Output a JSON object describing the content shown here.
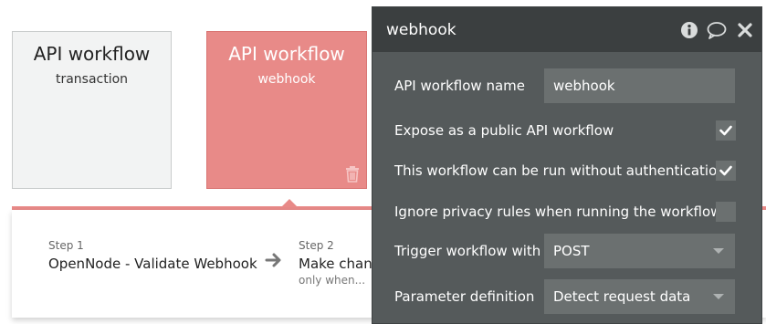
{
  "cards": [
    {
      "title": "API workflow",
      "subtitle": "transaction"
    },
    {
      "title": "API workflow",
      "subtitle": "webhook"
    }
  ],
  "steps": [
    {
      "number": "Step 1",
      "title": "OpenNode - Validate Webhook",
      "condition": ""
    },
    {
      "number": "Step 2",
      "title": "Make chang",
      "condition": "only when..."
    }
  ],
  "panel": {
    "title": "webhook",
    "fields": {
      "name_label": "API workflow name",
      "name_value": "webhook",
      "expose_label": "Expose as a public API workflow",
      "expose_checked": true,
      "noauth_label": "This workflow can be run without authentication",
      "noauth_checked": true,
      "privacy_label": "Ignore privacy rules when running the workflow",
      "privacy_checked": false,
      "trigger_label": "Trigger workflow with",
      "trigger_value": "POST",
      "param_label": "Parameter definition",
      "param_value": "Detect request data"
    }
  },
  "icons": {
    "trash": "trash-icon",
    "arrow": "arrow-right-icon",
    "info": "info-icon",
    "comment": "comment-icon",
    "close": "close-icon",
    "check": "checkmark-icon",
    "caret": "chevron-down-icon"
  },
  "colors": {
    "accent": "#e88a88",
    "panel_bg": "#555a5b",
    "panel_header": "#3b3f40",
    "input_bg": "#6b7070"
  }
}
